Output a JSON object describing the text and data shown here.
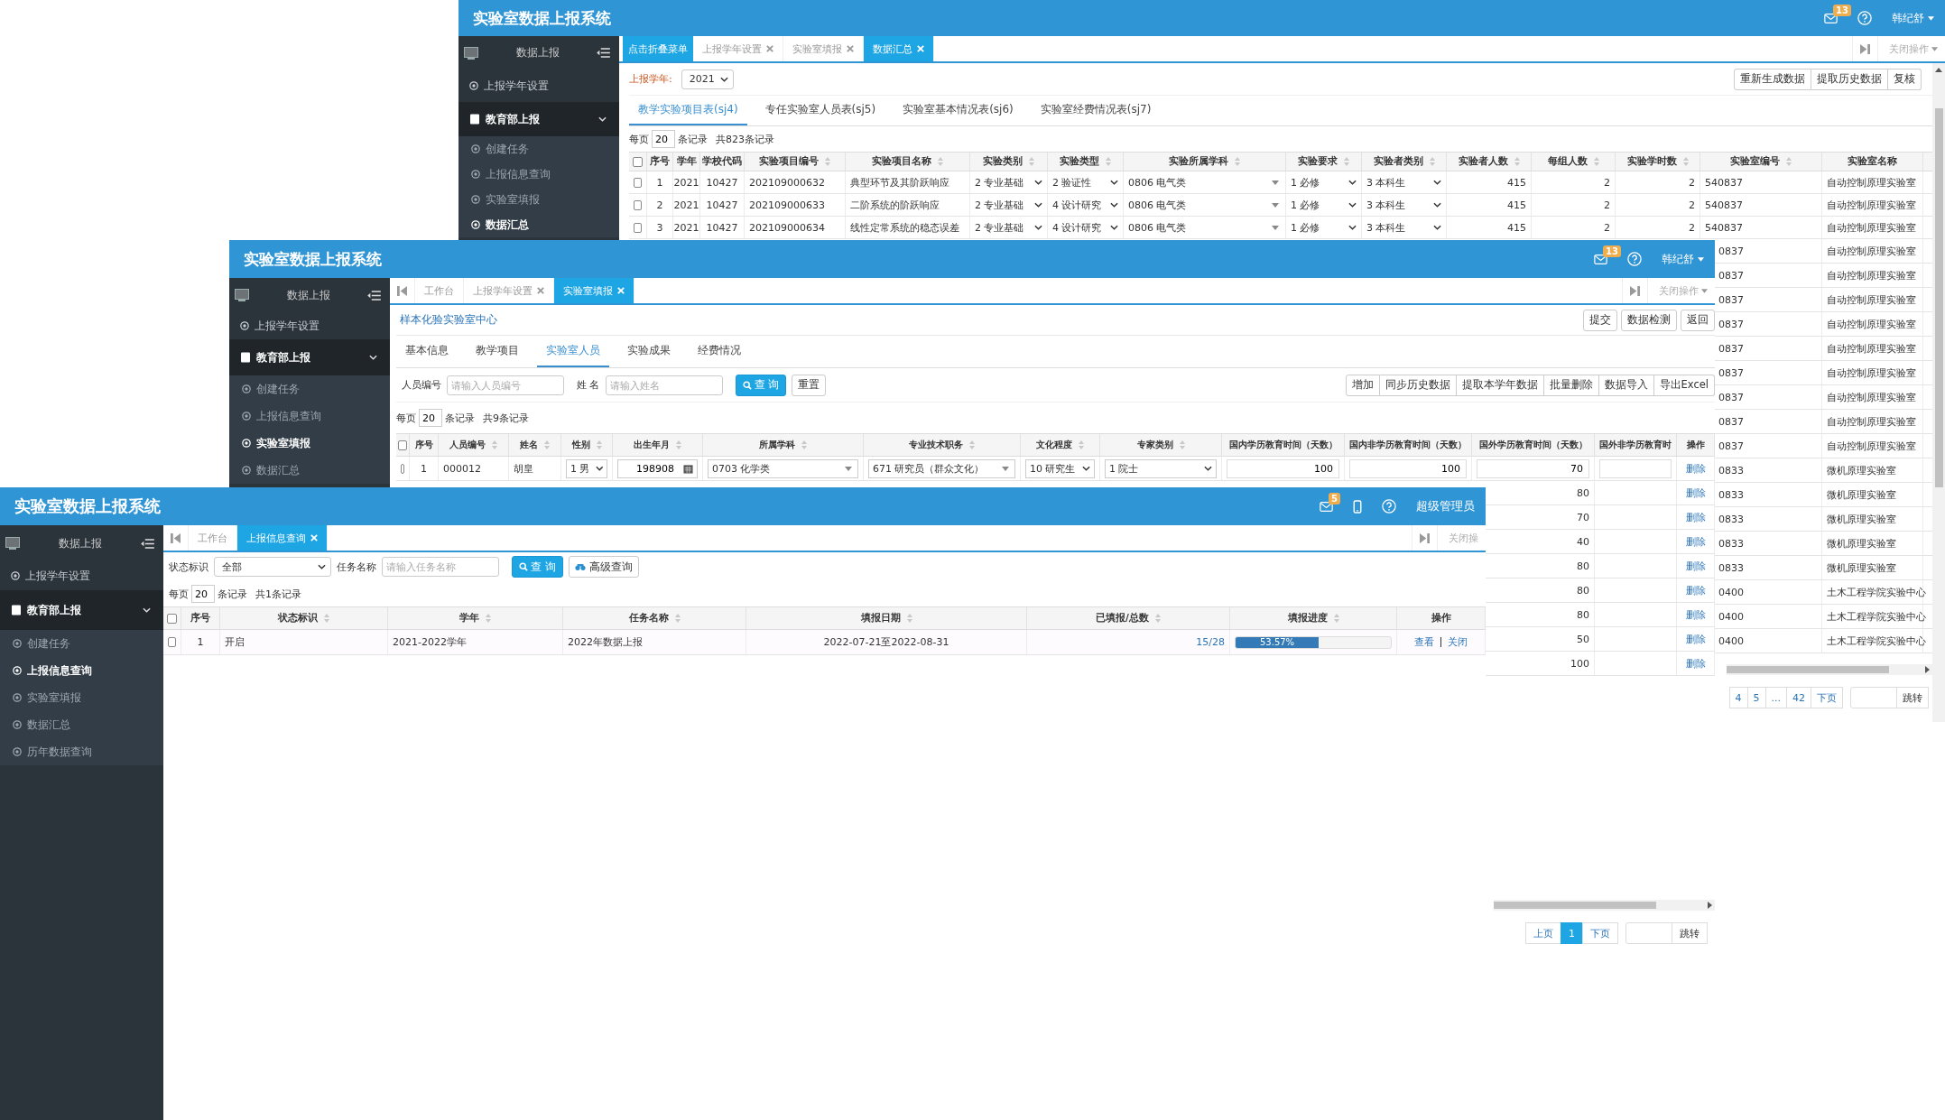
{
  "back_window": {
    "header": {
      "title": "实验室数据上报系统",
      "mail_badge": "13",
      "user": "韩纪舒"
    },
    "sidebar": {
      "heading": "数据上报",
      "items": [
        {
          "label": "上报学年设置",
          "selected": false
        },
        {
          "label": "教育部上报",
          "selected": false,
          "expanded": true,
          "children": [
            {
              "label": "创建任务",
              "selected": false
            },
            {
              "label": "上报信息查询",
              "selected": false
            },
            {
              "label": "实验室填报",
              "selected": false
            },
            {
              "label": "数据汇总",
              "selected": true
            }
          ]
        }
      ]
    },
    "tooltip": "点击折叠菜单",
    "tabs": [
      {
        "label": "上报学年设置",
        "selected": false,
        "closable": true
      },
      {
        "label": "实验室填报",
        "selected": false,
        "closable": true
      },
      {
        "label": "数据汇总",
        "selected": true,
        "closable": true
      }
    ],
    "close_menu": "关闭操作",
    "year_label": "上报学年:",
    "year_value": "2021",
    "actions": [
      "重新生成数据",
      "提取历史数据",
      "复核"
    ],
    "subtabs": [
      {
        "label": "教学实验项目表(sj4)",
        "selected": true
      },
      {
        "label": "专任实验室人员表(sj5)",
        "selected": false
      },
      {
        "label": "实验室基本情况表(sj6)",
        "selected": false
      },
      {
        "label": "实验室经费情况表(sj7)",
        "selected": false
      }
    ],
    "paging": {
      "prefix": "每页",
      "size": "20",
      "unit": "条记录",
      "total": "共823条记录"
    },
    "table": {
      "columns": [
        {
          "label": "序号",
          "kind": "index",
          "sortable": false
        },
        {
          "label": "学年",
          "kind": "index",
          "sortable": false
        },
        {
          "label": "学校代码",
          "kind": "index",
          "sortable": false
        },
        {
          "label": "实验项目编号",
          "kind": "text",
          "sortable": true
        },
        {
          "label": "实验项目名称",
          "kind": "text",
          "sortable": true
        },
        {
          "label": "实验类别",
          "kind": "select",
          "sortable": true
        },
        {
          "label": "实验类型",
          "kind": "select",
          "sortable": true
        },
        {
          "label": "实验所属学科",
          "kind": "combo",
          "sortable": true
        },
        {
          "label": "实验要求",
          "kind": "select",
          "sortable": true
        },
        {
          "label": "实验者类别",
          "kind": "select",
          "sortable": true
        },
        {
          "label": "实验者人数",
          "kind": "number",
          "sortable": true
        },
        {
          "label": "每组人数",
          "kind": "number",
          "sortable": true
        },
        {
          "label": "实验学时数",
          "kind": "number",
          "sortable": true
        },
        {
          "label": "实验室编号",
          "kind": "text",
          "sortable": true
        },
        {
          "label": "实验室名称",
          "kind": "text",
          "sortable": false
        }
      ],
      "all_checked": false,
      "rows": [
        {
          "checked": false,
          "cells": [
            "1",
            "2021",
            "10427",
            "202109000632",
            "典型环节及其阶跃响应",
            "2 专业基础",
            "2 验证性",
            "0806 电气类",
            "1 必修",
            "3 本科生",
            "415",
            "2",
            "2",
            "540837",
            "自动控制原理实验室"
          ]
        },
        {
          "checked": false,
          "cells": [
            "2",
            "2021",
            "10427",
            "202109000633",
            "二阶系统的阶跃响应",
            "2 专业基础",
            "4 设计研究",
            "0806 电气类",
            "1 必修",
            "3 本科生",
            "415",
            "2",
            "2",
            "540837",
            "自动控制原理实验室"
          ]
        },
        {
          "checked": false,
          "cells": [
            "3",
            "2021",
            "10427",
            "202109000634",
            "线性定常系统的稳态误差",
            "2 专业基础",
            "4 设计研究",
            "0806 电气类",
            "1 必修",
            "3 本科生",
            "415",
            "2",
            "2",
            "540837",
            "自动控制原理实验室"
          ]
        }
      ],
      "clipped_rows": [
        {
          "lab_no": "0837",
          "lab_name": "自动控制原理实验室"
        },
        {
          "lab_no": "0837",
          "lab_name": "自动控制原理实验室"
        },
        {
          "lab_no": "0837",
          "lab_name": "自动控制原理实验室"
        },
        {
          "lab_no": "0837",
          "lab_name": "自动控制原理实验室"
        },
        {
          "lab_no": "0837",
          "lab_name": "自动控制原理实验室"
        },
        {
          "lab_no": "0837",
          "lab_name": "自动控制原理实验室"
        },
        {
          "lab_no": "0837",
          "lab_name": "自动控制原理实验室"
        },
        {
          "lab_no": "0837",
          "lab_name": "自动控制原理实验室"
        },
        {
          "lab_no": "0837",
          "lab_name": "自动控制原理实验室"
        },
        {
          "lab_no": "0833",
          "lab_name": "微机原理实验室"
        },
        {
          "lab_no": "0833",
          "lab_name": "微机原理实验室"
        },
        {
          "lab_no": "0833",
          "lab_name": "微机原理实验室"
        },
        {
          "lab_no": "0833",
          "lab_name": "微机原理实验室"
        },
        {
          "lab_no": "0833",
          "lab_name": "微机原理实验室"
        },
        {
          "lab_no": "0400",
          "lab_name": "土木工程学院实验中心"
        },
        {
          "lab_no": "0400",
          "lab_name": "土木工程学院实验中心"
        },
        {
          "lab_no": "0400",
          "lab_name": "土木工程学院实验中心"
        }
      ]
    },
    "pagination": {
      "pages": [
        {
          "label": "4",
          "selected": false
        },
        {
          "label": "5",
          "selected": false
        },
        {
          "label": "...",
          "selected": false
        },
        {
          "label": "42",
          "selected": false
        }
      ],
      "next": "下页",
      "jump": "跳转"
    }
  },
  "middle_window": {
    "header": {
      "title": "实验室数据上报系统",
      "mail_badge": "13",
      "user": "韩纪舒"
    },
    "sidebar": {
      "heading": "数据上报",
      "items": [
        {
          "label": "上报学年设置",
          "selected": false
        },
        {
          "label": "教育部上报",
          "selected": false,
          "expanded": true,
          "children": [
            {
              "label": "创建任务",
              "selected": false
            },
            {
              "label": "上报信息查询",
              "selected": false
            },
            {
              "label": "实验室填报",
              "selected": true
            },
            {
              "label": "数据汇总",
              "selected": false
            }
          ]
        }
      ]
    },
    "tabs": [
      {
        "label": "工作台",
        "selected": false,
        "closable": false
      },
      {
        "label": "上报学年设置",
        "selected": false,
        "closable": true
      },
      {
        "label": "实验室填报",
        "selected": true,
        "closable": true
      }
    ],
    "close_menu": "关闭操作",
    "center_name": "样本化验实验室中心",
    "actions": [
      "提交",
      "数据检测",
      "返回"
    ],
    "subtabs": [
      {
        "label": "基本信息",
        "selected": false
      },
      {
        "label": "教学项目",
        "selected": false
      },
      {
        "label": "实验室人员",
        "selected": true
      },
      {
        "label": "实验成果",
        "selected": false
      },
      {
        "label": "经费情况",
        "selected": false
      }
    ],
    "filters": [
      {
        "label": "人员编号",
        "placeholder": "请输入人员编号"
      },
      {
        "label": "姓 名",
        "placeholder": "请输入姓名"
      }
    ],
    "search_button": "查 询",
    "reset_button": "重置",
    "table_actions": [
      "增加",
      "同步历史数据",
      "提取本学年数据",
      "批量删除",
      "数据导入",
      "导出Excel"
    ],
    "paging": {
      "prefix": "每页",
      "size": "20",
      "unit": "条记录",
      "total": "共9条记录"
    },
    "table": {
      "columns": [
        {
          "label": "序号",
          "kind": "index",
          "sortable": false
        },
        {
          "label": "人员编号",
          "kind": "text",
          "sortable": true
        },
        {
          "label": "姓名",
          "kind": "text",
          "sortable": true
        },
        {
          "label": "性别",
          "kind": "select",
          "sortable": true
        },
        {
          "label": "出生年月",
          "kind": "datepicker",
          "sortable": true
        },
        {
          "label": "所属学科",
          "kind": "combo",
          "sortable": true
        },
        {
          "label": "专业技术职务",
          "kind": "combo",
          "sortable": true
        },
        {
          "label": "文化程度",
          "kind": "select",
          "sortable": true
        },
        {
          "label": "专家类别",
          "kind": "select",
          "sortable": true
        },
        {
          "label": "国内学历教育时间（天数）",
          "kind": "input",
          "sortable": false
        },
        {
          "label": "国内非学历教育时间（天数）",
          "kind": "input",
          "sortable": false
        },
        {
          "label": "国外学历教育时间（天数）",
          "kind": "input",
          "sortable": false
        },
        {
          "label": "国外非学历教育时",
          "kind": "input",
          "sortable": false
        },
        {
          "label": "操作",
          "kind": "action",
          "sortable": false
        }
      ],
      "all_checked": false,
      "rows": [
        {
          "checked": false,
          "cells": [
            "1",
            "000012",
            "胡皇",
            "1 男",
            "198908",
            "0703 化学类",
            "671 研究员（群众文化）",
            "10 研究生",
            "1 院士",
            "100",
            "100",
            "70"
          ],
          "action": "删除"
        }
      ],
      "clipped_rows": [
        {
          "value": "80",
          "action": "删除"
        },
        {
          "value": "70",
          "action": "删除"
        },
        {
          "value": "40",
          "action": "删除"
        },
        {
          "value": "80",
          "action": "删除"
        },
        {
          "value": "80",
          "action": "删除"
        },
        {
          "value": "80",
          "action": "删除"
        },
        {
          "value": "50",
          "action": "删除"
        },
        {
          "value": "100",
          "action": "删除"
        }
      ]
    },
    "pagination": {
      "prev": "上页",
      "pages": [
        {
          "label": "1",
          "selected": true
        }
      ],
      "next": "下页",
      "jump": "跳转"
    }
  },
  "front_window": {
    "header": {
      "title": "实验室数据上报系统",
      "mail_badge": "5",
      "user": "超级管理员"
    },
    "sidebar": {
      "heading": "数据上报",
      "items": [
        {
          "label": "上报学年设置",
          "selected": false
        },
        {
          "label": "教育部上报",
          "selected": false,
          "expanded": true,
          "children": [
            {
              "label": "创建任务",
              "selected": false
            },
            {
              "label": "上报信息查询",
              "selected": true
            },
            {
              "label": "实验室填报",
              "selected": false
            },
            {
              "label": "数据汇总",
              "selected": false
            },
            {
              "label": "历年数据查询",
              "selected": false
            }
          ]
        }
      ]
    },
    "tabs": [
      {
        "label": "工作台",
        "selected": false,
        "closable": false
      },
      {
        "label": "上报信息查询",
        "selected": true,
        "closable": true
      }
    ],
    "close_menu": "关闭操",
    "status_filter": {
      "label": "状态标识",
      "value": "全部"
    },
    "name_filter": {
      "label": "任务名称",
      "placeholder": "请输入任务名称"
    },
    "search_button": "查 询",
    "advanced_button": "高级查询",
    "paging": {
      "prefix": "每页",
      "size": "20",
      "unit": "条记录",
      "total": "共1条记录"
    },
    "table": {
      "columns": [
        {
          "label": "序号",
          "kind": "index",
          "sortable": false
        },
        {
          "label": "状态标识",
          "kind": "text",
          "sortable": true
        },
        {
          "label": "学年",
          "kind": "text",
          "sortable": true
        },
        {
          "label": "任务名称",
          "kind": "text",
          "sortable": true
        },
        {
          "label": "填报日期",
          "kind": "date",
          "sortable": true
        },
        {
          "label": "已填报/总数",
          "kind": "link",
          "sortable": true
        },
        {
          "label": "填报进度",
          "kind": "progress",
          "sortable": true
        },
        {
          "label": "操作",
          "kind": "actions",
          "sortable": false
        }
      ],
      "all_checked": false,
      "rows": [
        {
          "checked": false,
          "cells": [
            "1",
            "开启",
            "2021-2022学年",
            "2022年数据上报",
            "2022-07-21至2022-08-31",
            "15/28"
          ],
          "progress": {
            "level": 0.5357,
            "label": "53.57%"
          },
          "actions": [
            "查看",
            "关闭"
          ]
        }
      ]
    }
  }
}
